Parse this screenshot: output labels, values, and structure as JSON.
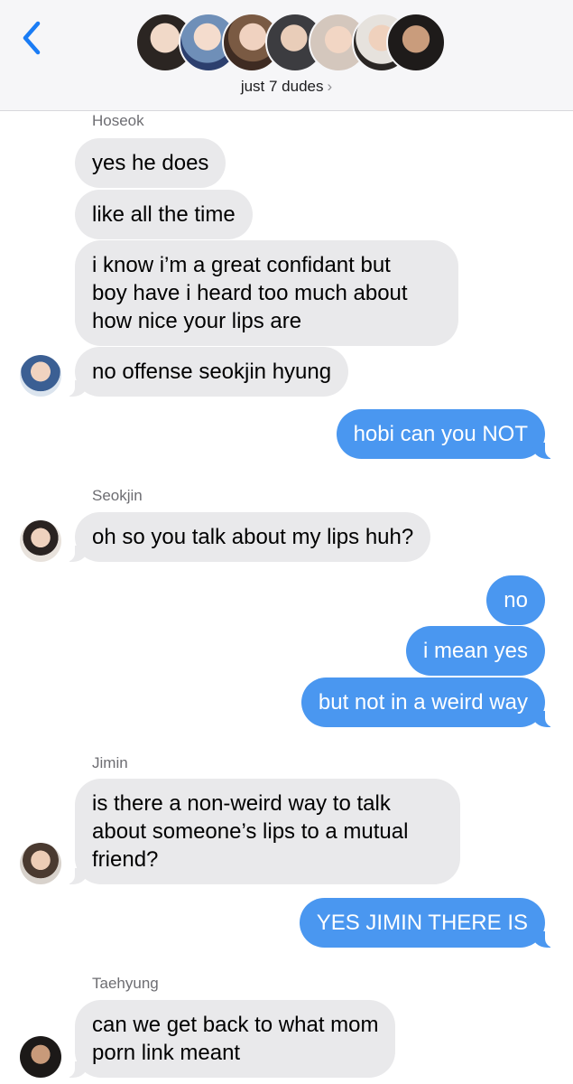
{
  "header": {
    "group_name": "just 7 dudes",
    "chevron": "›"
  },
  "messages": [
    {
      "sender": "Hoseok"
    },
    {
      "text": "yes he does"
    },
    {
      "text": "like all the time"
    },
    {
      "lines": [
        "i know i’m a great confidant but",
        "boy have i heard too much about",
        "how nice your lips are"
      ]
    },
    {
      "text": "no offense seokjin hyung"
    },
    {
      "text": "hobi can you NOT"
    },
    {
      "sender": "Seokjin"
    },
    {
      "text": "oh so you talk about my lips huh?"
    },
    {
      "text": "no"
    },
    {
      "text": "i mean yes"
    },
    {
      "text": "but not in a weird way"
    },
    {
      "sender": "Jimin"
    },
    {
      "lines": [
        "is there a non-weird way to talk",
        "about someone’s lips to a mutual",
        "friend?"
      ]
    },
    {
      "text": "YES JIMIN THERE IS"
    },
    {
      "sender": "Taehyung"
    },
    {
      "lines": [
        "can we get back to what mom",
        "porn link meant"
      ]
    }
  ],
  "colors": {
    "incoming_bubble": "#e9e9eb",
    "outgoing_bubble": "#4a97f0",
    "back_chevron": "#1a7cf5"
  }
}
